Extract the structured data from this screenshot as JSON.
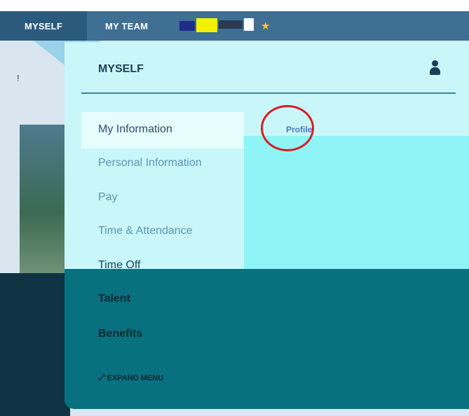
{
  "nav": {
    "tabs": [
      {
        "label": "MYSELF",
        "active": true
      },
      {
        "label": "MY TEAM",
        "active": false
      }
    ],
    "favorite_icon": "star-icon"
  },
  "menu": {
    "title": "MYSELF",
    "user_icon": "user-icon",
    "items": [
      {
        "label": "My Information",
        "style": "selected"
      },
      {
        "label": "Personal Information",
        "style": "link"
      },
      {
        "label": "Pay",
        "style": "link"
      },
      {
        "label": "Time & Attendance",
        "style": "link"
      },
      {
        "label": "Time Off",
        "style": "link"
      },
      {
        "label": "Talent",
        "style": "bold"
      },
      {
        "label": "Benefits",
        "style": "bold"
      }
    ],
    "submenu": {
      "label": "Profile"
    },
    "expand_label": "EXPAND MENU",
    "expand_icon": "expand-arrow-icon"
  },
  "colors": {
    "nav_bar": "#3f6f93",
    "panel": "#c9f7f9",
    "panel_lower": "#08707e",
    "highlight_circle": "#d41f25",
    "title_text": "#1d3c58"
  }
}
